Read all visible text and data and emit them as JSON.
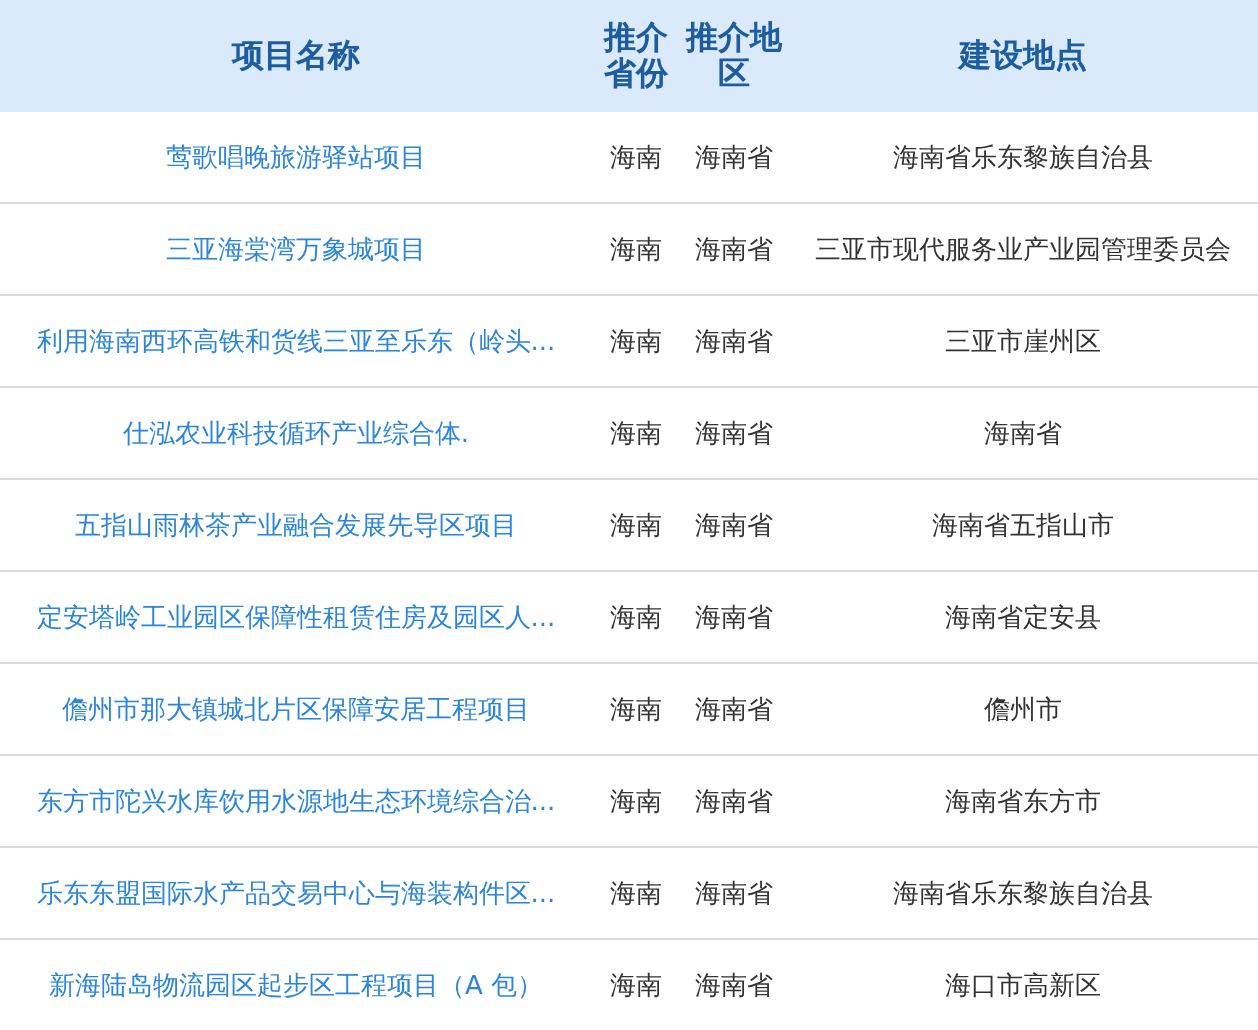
{
  "table": {
    "columns": [
      "项目名称",
      "推介省份",
      "推介地区",
      "建设地点"
    ],
    "rows": [
      {
        "name": "莺歌唱晚旅游驿站项目",
        "province": "海南",
        "region": "海南省",
        "location": "海南省乐东黎族自治县"
      },
      {
        "name": "三亚海棠湾万象城项目",
        "province": "海南",
        "region": "海南省",
        "location": "三亚市现代服务业产业园管理委员会"
      },
      {
        "name": "利用海南西环高铁和货线三亚至乐东（岭头...",
        "province": "海南",
        "region": "海南省",
        "location": "三亚市崖州区"
      },
      {
        "name": "仕泓农业科技循环产业综合体.",
        "province": "海南",
        "region": "海南省",
        "location": "海南省"
      },
      {
        "name": "五指山雨林茶产业融合发展先导区项目",
        "province": "海南",
        "region": "海南省",
        "location": "海南省五指山市"
      },
      {
        "name": "定安塔岭工业园区保障性租赁住房及园区人...",
        "province": "海南",
        "region": "海南省",
        "location": "海南省定安县"
      },
      {
        "name": "儋州市那大镇城北片区保障安居工程项目",
        "province": "海南",
        "region": "海南省",
        "location": "儋州市"
      },
      {
        "name": "东方市陀兴水库饮用水源地生态环境综合治...",
        "province": "海南",
        "region": "海南省",
        "location": "海南省东方市"
      },
      {
        "name": "乐东东盟国际水产品交易中心与海装构件区...",
        "province": "海南",
        "region": "海南省",
        "location": "海南省乐东黎族自治县"
      },
      {
        "name": "新海陆岛物流园区起步区工程项目（A 包）",
        "province": "海南",
        "region": "海南省",
        "location": "海口市高新区"
      }
    ]
  }
}
